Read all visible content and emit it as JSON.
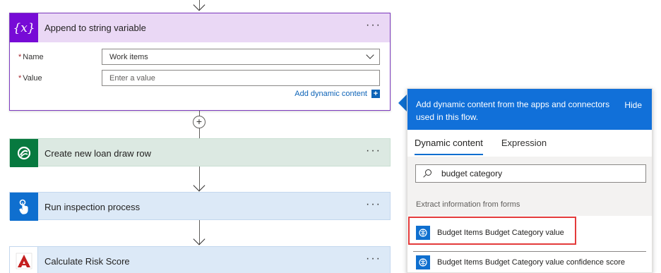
{
  "cards": {
    "append": {
      "icon": "variable-icon",
      "icon_glyph": "{x}",
      "title": "Append to string variable",
      "name_label": "Name",
      "name_value": "Work items",
      "value_label": "Value",
      "value_placeholder": "Enter a value",
      "add_dynamic_label": "Add dynamic content",
      "more": "···"
    },
    "loan": {
      "icon": "dataverse-icon",
      "title": "Create new loan draw row",
      "more": "···"
    },
    "inspection": {
      "icon": "touch-icon",
      "title": "Run inspection process",
      "more": "···"
    },
    "risk": {
      "icon": "adobe-acrobat-icon",
      "title": "Calculate Risk Score",
      "more": "···"
    }
  },
  "insert_step": "+",
  "dynamic_panel": {
    "header_text": "Add dynamic content from the apps and connectors used in this flow.",
    "hide_label": "Hide",
    "tabs": [
      "Dynamic content",
      "Expression"
    ],
    "active_tab": "Dynamic content",
    "search_value": "budget category",
    "section_title": "Extract information from forms",
    "items": [
      {
        "label": "Budget Items Budget Category value",
        "icon": "ai-builder-icon"
      },
      {
        "label": "Budget Items Budget Category value confidence score",
        "icon": "ai-builder-icon"
      }
    ],
    "highlight_color": "#e43b3b",
    "accent_color": "#1170d9"
  }
}
